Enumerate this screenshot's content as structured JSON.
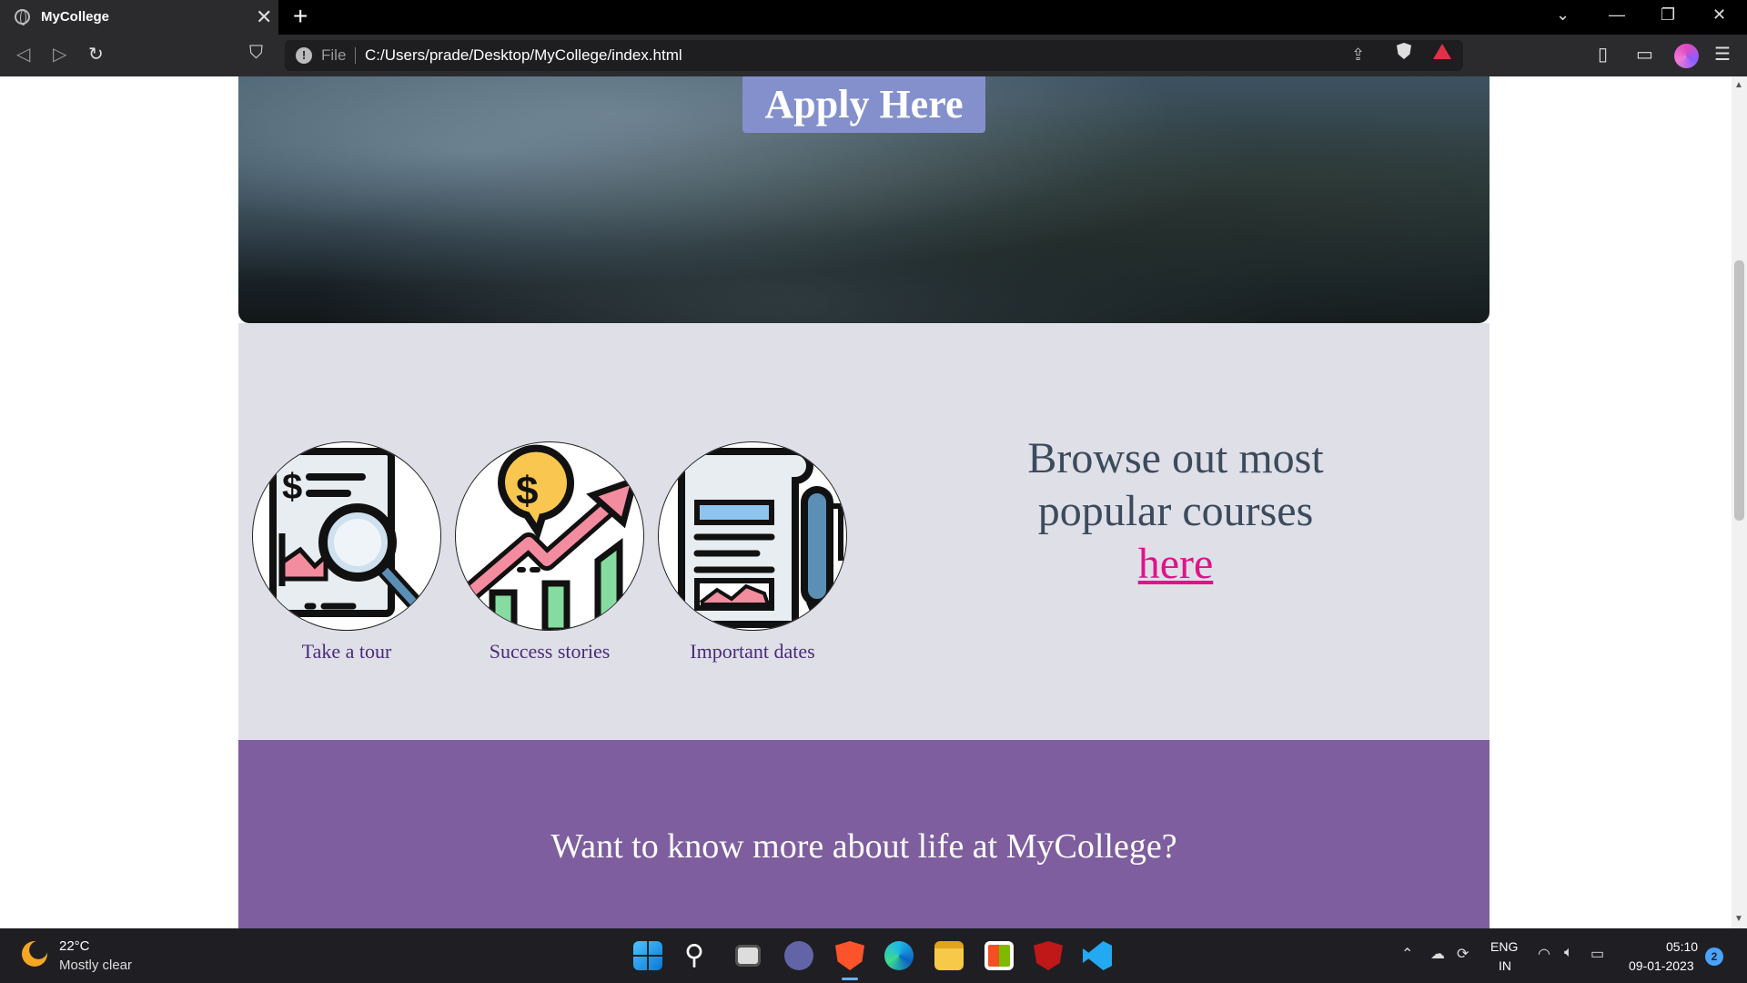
{
  "browser": {
    "tab_title": "MyCollege",
    "tab_close": "✕",
    "new_tab": "+",
    "url_scheme": "File",
    "url": "C:/Users/prade/Desktop/MyCollege/index.html"
  },
  "page": {
    "apply_button": "Apply Here",
    "features": [
      {
        "label": "Take a tour",
        "icon": "document-magnifier-icon"
      },
      {
        "label": "Success stories",
        "icon": "growth-chart-dollar-icon"
      },
      {
        "label": "Important dates",
        "icon": "newspaper-pen-icon"
      }
    ],
    "browse": {
      "line1": "Browse out most",
      "line2": "popular courses",
      "link": "here"
    },
    "life_heading": "Want to know more about life at MyCollege?"
  },
  "colors": {
    "apply_button": "#8490cc",
    "features_bg": "#dfdfe8",
    "link": "#e0138a",
    "life_bg": "#7e5e9e"
  },
  "taskbar": {
    "temperature": "22°C",
    "condition": "Mostly clear",
    "lang_top": "ENG",
    "lang_bottom": "IN",
    "time": "05:10",
    "date": "09-01-2023",
    "notifications": "2"
  }
}
